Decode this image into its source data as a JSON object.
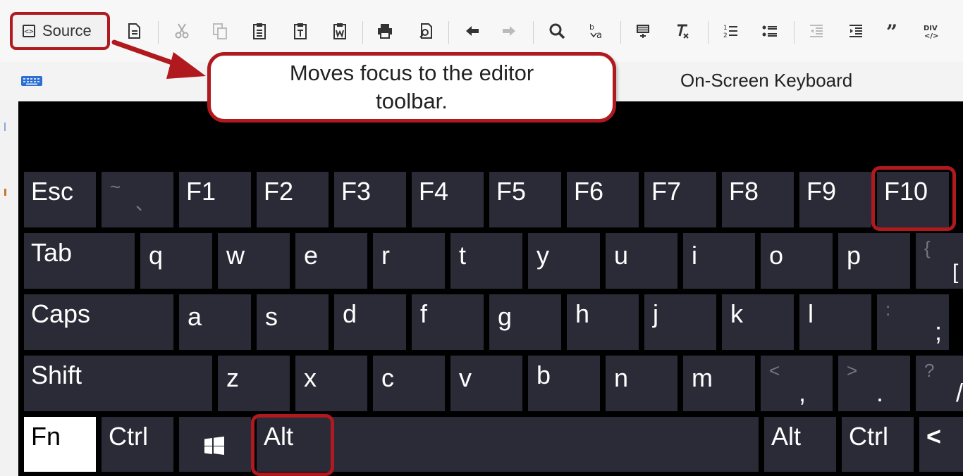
{
  "toolbar": {
    "source_label": "Source",
    "div_label": "DIV"
  },
  "callout": {
    "text": "Moves focus to the editor toolbar."
  },
  "osk": {
    "title": "On-Screen Keyboard"
  },
  "keys": {
    "esc": "Esc",
    "tilde_top": "~",
    "tilde_bottom": "、",
    "f1": "F1",
    "f2": "F2",
    "f3": "F3",
    "f4": "F4",
    "f5": "F5",
    "f6": "F6",
    "f7": "F7",
    "f8": "F8",
    "f9": "F9",
    "f10": "F10",
    "tab": "Tab",
    "q": "q",
    "w": "w",
    "e": "e",
    "r": "r",
    "t": "t",
    "y": "y",
    "u": "u",
    "i": "i",
    "o": "o",
    "p": "p",
    "brace_top": "{",
    "brace_bottom": "[",
    "caps": "Caps",
    "a": "a",
    "s": "s",
    "d": "d",
    "f": "f",
    "g": "g",
    "h": "h",
    "j": "j",
    "k": "k",
    "l": "l",
    "colon_top": ":",
    "colon_bottom": ";",
    "shift": "Shift",
    "z": "z",
    "x": "x",
    "c": "c",
    "v": "v",
    "b": "b",
    "n": "n",
    "m": "m",
    "lt_top": "<",
    "lt_bottom": ",",
    "gt_top": ">",
    "gt_bottom": ".",
    "q_top": "?",
    "q_bottom": "/",
    "fn": "Fn",
    "ctrl_left": "Ctrl",
    "alt_left": "Alt",
    "alt_right": "Alt",
    "ctrl_right": "Ctrl",
    "left_arrow": "<"
  },
  "colors": {
    "highlight": "#b0191e",
    "key_bg": "#2b2b38",
    "keyboard_bg": "#000000"
  }
}
